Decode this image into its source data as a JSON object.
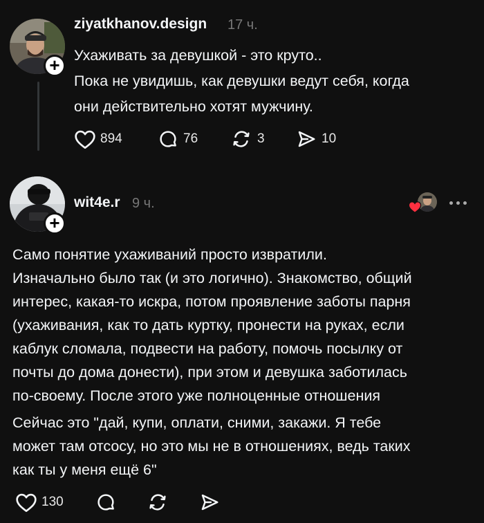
{
  "post1": {
    "username": "ziyatkhanov.design",
    "time": "17 ч.",
    "line1": "Ухаживать за девушкой - это круто..",
    "line2": "Пока не увидишь, как девушки ведут себя, когда",
    "line3": "они действительно хотят мужчину.",
    "likes": "894",
    "comments": "76",
    "reposts": "3",
    "shares": "10"
  },
  "post2": {
    "username": "wit4e.r",
    "time": "9 ч.",
    "paragraph1": [
      "Само понятие ухаживаний просто извратили.",
      "Изначально было так (и это логично). Знакомство, общий",
      "интерес, какая-то искра, потом проявление заботы парня",
      "(ухаживания, как то дать куртку, пронести на руках, если",
      "каблук сломала, подвести на работу, помочь посылку от",
      "почты до дома донести), при этом и девушка заботилась",
      "по-своему. После этого уже полноценные отношения"
    ],
    "paragraph2": [
      "Сейчас это \"дай, купи, оплати, сними, закажи. Я тебе",
      "может там отсосу, но это мы не в отношениях, ведь таких",
      "как ты у меня ещё 6\""
    ],
    "likes": "130"
  },
  "icons": [
    "plus-icon",
    "heart-icon",
    "comment-icon",
    "repost-icon",
    "share-icon",
    "more-icon",
    "liked-by-heart-icon"
  ],
  "colors": {
    "background": "#101010",
    "text": "#f3f5f7",
    "muted": "#777777",
    "like_red": "#ff3040"
  }
}
